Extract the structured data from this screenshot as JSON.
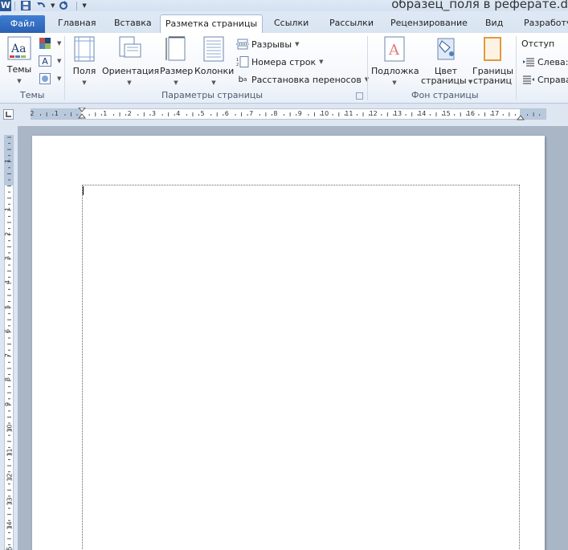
{
  "window": {
    "title": "образец_поля в реферате.d",
    "app_icon": "word-icon"
  },
  "quick_access": [
    "save-icon",
    "undo-icon",
    "redo-icon",
    "customize-icon"
  ],
  "tabs": {
    "file": "Файл",
    "items": [
      "Главная",
      "Вставка",
      "Разметка страницы",
      "Ссылки",
      "Рассылки",
      "Рецензирование",
      "Вид",
      "Разработч"
    ],
    "active": "Разметка страницы"
  },
  "ribbon": {
    "themes": {
      "button": "Темы",
      "group_label": "Темы"
    },
    "page_setup": {
      "fields": "Поля",
      "orientation": "Ориентация",
      "size": "Размер",
      "columns": "Колонки",
      "breaks": "Разрывы",
      "line_numbers": "Номера строк",
      "hyphenation": "Расстановка переносов",
      "group_label": "Параметры страницы"
    },
    "background": {
      "watermark": "Подложка",
      "page_color_1": "Цвет",
      "page_color_2": "страницы",
      "borders_1": "Границы",
      "borders_2": "страниц",
      "group_label": "Фон страницы"
    },
    "paragraph": {
      "indent": "Отступ",
      "left": "Слева:",
      "right": "Справа"
    }
  },
  "ruler": {
    "h_numbers": [
      "2",
      "1",
      "1",
      "2",
      "3",
      "4",
      "5",
      "6",
      "7",
      "8",
      "9",
      "10",
      "11",
      "12",
      "13",
      "14",
      "15",
      "16",
      "17"
    ],
    "v_numbers": [
      "1",
      "1",
      "2",
      "3",
      "4",
      "5",
      "6",
      "7",
      "8",
      "9",
      "10",
      "11",
      "12",
      "13",
      "14",
      "15"
    ]
  },
  "colors": {
    "accent": "#2b5797",
    "file_tab": "#2a5fb0",
    "workspace": "#a9b6c6"
  }
}
